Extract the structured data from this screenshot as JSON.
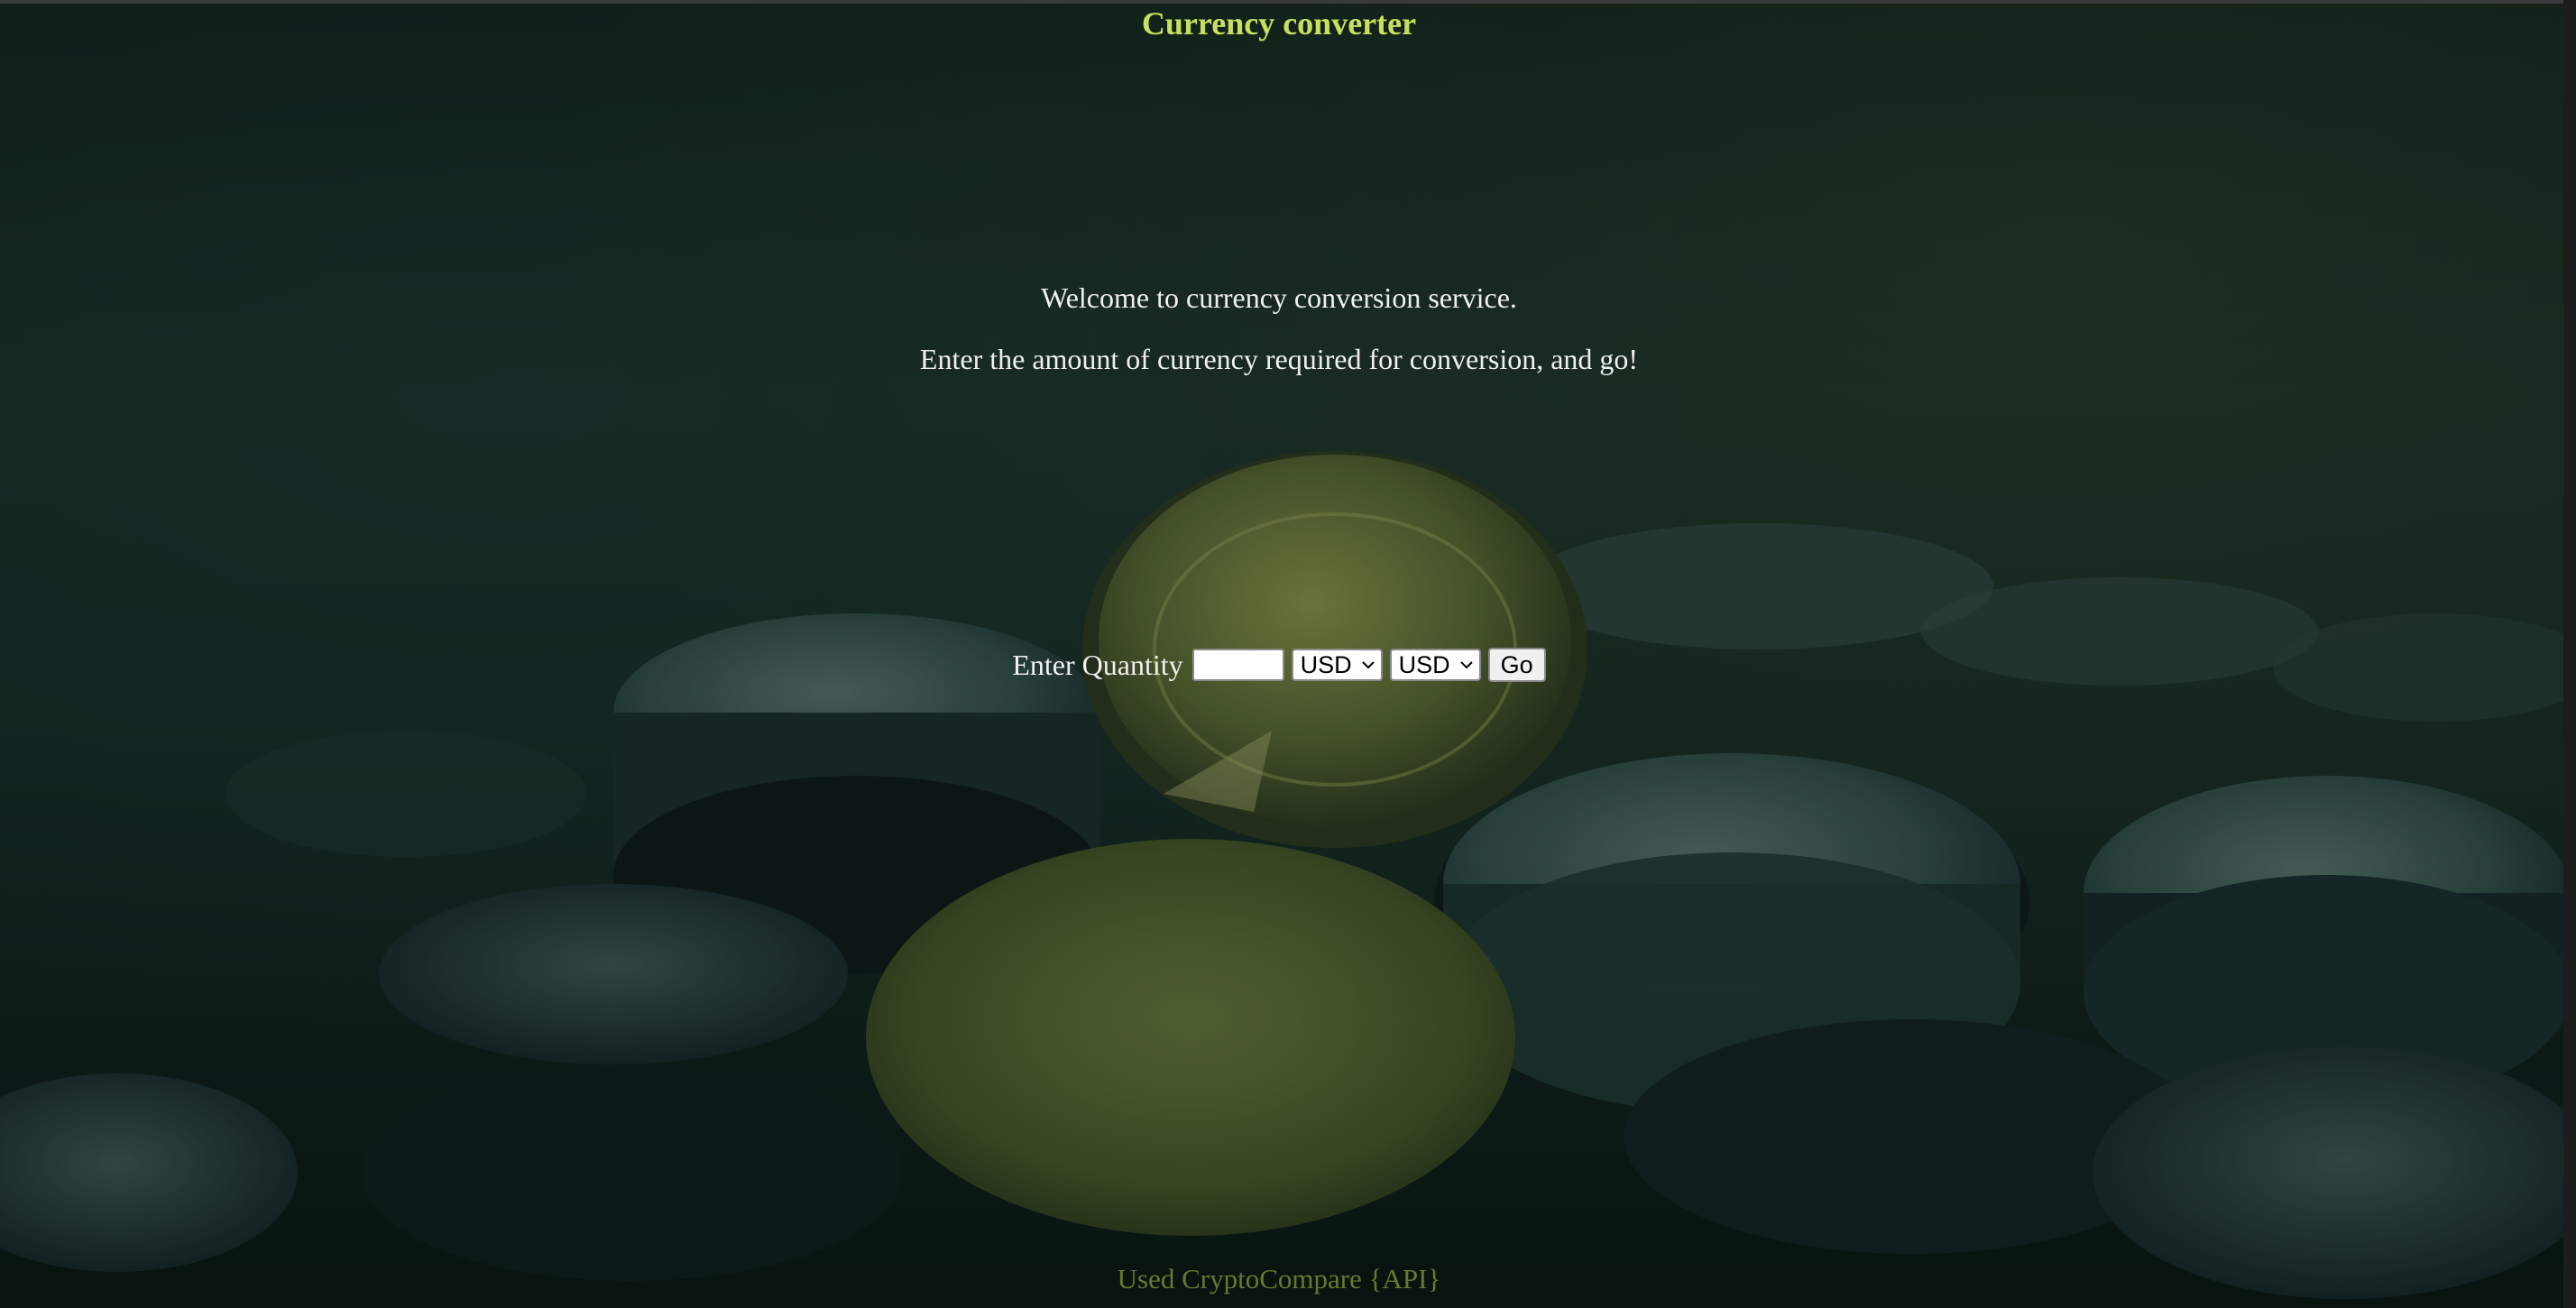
{
  "page": {
    "title": "Currency converter",
    "welcome": "Welcome to currency conversion service.",
    "instruction": "Enter the amount of currency required for conversion, and go!"
  },
  "form": {
    "quantity_label": "Enter Quantity",
    "quantity_value": "",
    "from_currency": "USD",
    "to_currency": "USD",
    "go_label": "Go"
  },
  "footer": {
    "text": "Used CryptoCompare {API}"
  },
  "colors": {
    "title": "#c6e05e",
    "body_text": "#f0f0f0",
    "footer": "#667a2c",
    "background": "#0f1c17"
  },
  "icons": {
    "select_arrow": "chevron-down-icon"
  }
}
